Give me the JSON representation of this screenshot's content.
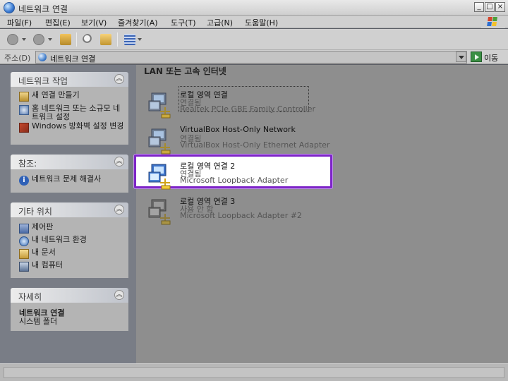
{
  "window": {
    "title": "네트워크 연결"
  },
  "menu": [
    "파일(F)",
    "편집(E)",
    "보기(V)",
    "즐겨찾기(A)",
    "도구(T)",
    "고급(N)",
    "도움말(H)"
  ],
  "address": {
    "label": "주소(D)",
    "value": "네트워크 연결",
    "go": "이동"
  },
  "sidebar": {
    "tasks": {
      "title": "네트워크 작업",
      "items": [
        "새 연결 만들기",
        "홈 네트워크 또는 소규모 네트워크 설정",
        "Windows 방화벽 설정 변경"
      ]
    },
    "see_also": {
      "title": "참조:",
      "items": [
        "네트워크 문제 해결사"
      ]
    },
    "other_places": {
      "title": "기타 위치",
      "items": [
        "제어판",
        "내 네트워크 환경",
        "내 문서",
        "내 컴퓨터"
      ]
    },
    "details": {
      "title": "자세히",
      "name": "네트워크 연결",
      "type": "시스템 폴더"
    }
  },
  "content": {
    "section": "LAN 또는 고속 인터넷",
    "connections": [
      {
        "name": "로컬 영역 연결",
        "status": "연결됨",
        "device": "Realtek PCIe GBE Family Controller"
      },
      {
        "name": "VirtualBox Host-Only Network",
        "status": "연결됨",
        "device": "VirtualBox Host-Only Ethernet Adapter"
      },
      {
        "name": "로컬 영역 연결 2",
        "status": "연결됨",
        "device": "Microsoft Loopback Adapter"
      },
      {
        "name": "로컬 영역 연결 3",
        "status": "사용 안 함",
        "device": "Microsoft Loopback Adapter #2"
      }
    ]
  },
  "colors": {
    "highlight_border": "#7e25c8",
    "dim_overlay": "#8e8e8e"
  }
}
